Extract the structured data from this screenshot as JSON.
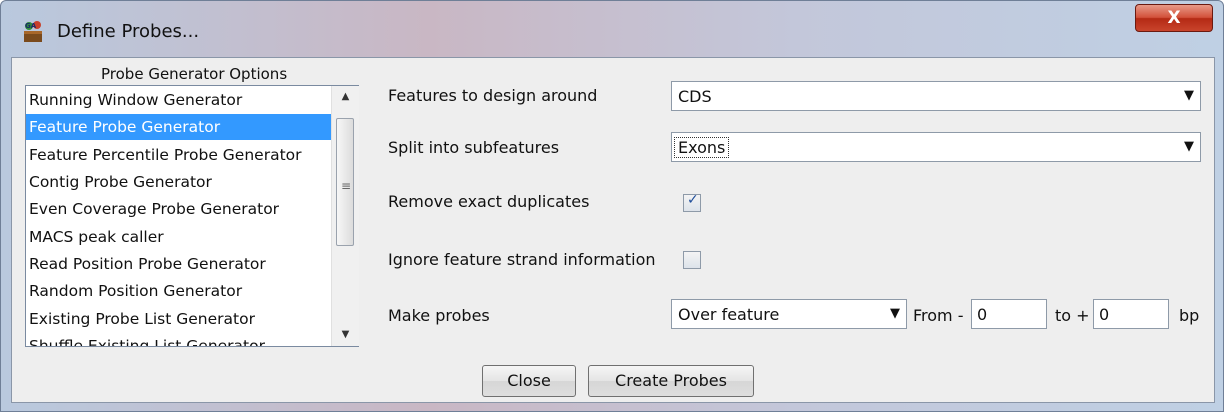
{
  "window": {
    "title": "Define Probes...",
    "close_glyph": "X"
  },
  "generator_list": {
    "title": "Probe Generator Options",
    "items": [
      {
        "label": "Running Window Generator",
        "selected": false
      },
      {
        "label": "Feature Probe Generator",
        "selected": true
      },
      {
        "label": "Feature Percentile Probe Generator",
        "selected": false
      },
      {
        "label": "Contig Probe Generator",
        "selected": false
      },
      {
        "label": "Even Coverage Probe Generator",
        "selected": false
      },
      {
        "label": "MACS peak caller",
        "selected": false
      },
      {
        "label": "Read Position Probe Generator",
        "selected": false
      },
      {
        "label": "Random Position Generator",
        "selected": false
      },
      {
        "label": "Existing Probe List Generator",
        "selected": false
      },
      {
        "label": "Shuffle Existing List Generator",
        "selected": false
      }
    ]
  },
  "options": {
    "features_label": "Features to design around",
    "features_value": "CDS",
    "split_label": "Split into subfeatures",
    "split_value": "Exons",
    "remove_duplicates_label": "Remove exact duplicates",
    "remove_duplicates_checked": true,
    "ignore_strand_label": "Ignore feature strand information",
    "ignore_strand_checked": false,
    "make_probes_label": "Make probes",
    "make_probes_value": "Over feature",
    "from_label": "From -",
    "from_value": "0",
    "to_label": "to +",
    "to_value": "0",
    "unit_label": "bp"
  },
  "buttons": {
    "close": "Close",
    "create": "Create Probes"
  },
  "colors": {
    "selection": "#3399ff",
    "close_button": "#c9442c",
    "check_mark": "#1f4e9a"
  }
}
